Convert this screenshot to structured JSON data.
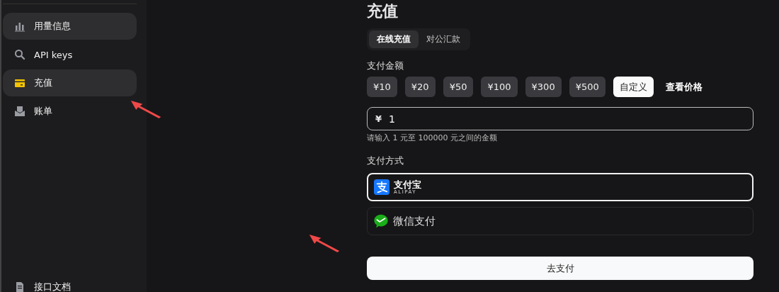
{
  "sidebar": {
    "items": [
      {
        "label": "用量信息",
        "kind": "chart",
        "selected": true
      },
      {
        "label": "API keys",
        "kind": "search",
        "selected": false
      },
      {
        "label": "充值",
        "kind": "card",
        "selected": true
      },
      {
        "label": "账单",
        "kind": "tray",
        "selected": false
      }
    ],
    "footer_item": {
      "label": "接口文档",
      "kind": "doc"
    }
  },
  "page": {
    "title": "充值",
    "tabs": [
      {
        "label": "在线充值",
        "selected": true
      },
      {
        "label": "对公汇款",
        "selected": false
      }
    ],
    "amount_label": "支付金额",
    "amounts": [
      {
        "label": "¥10",
        "kind": "chip",
        "selected": false
      },
      {
        "label": "¥20",
        "kind": "chip",
        "selected": false
      },
      {
        "label": "¥50",
        "kind": "chip",
        "selected": false
      },
      {
        "label": "¥100",
        "kind": "chip",
        "selected": false
      },
      {
        "label": "¥300",
        "kind": "chip",
        "selected": false
      },
      {
        "label": "¥500",
        "kind": "chip",
        "selected": false
      },
      {
        "label": "自定义",
        "kind": "chip",
        "selected": true
      },
      {
        "label": "查看价格",
        "kind": "link",
        "selected": false
      }
    ],
    "amount_input": {
      "prefix": "¥",
      "value": "1"
    },
    "hint": "请输入 1 元至 100000 元之间的金额",
    "method_label": "支付方式",
    "methods": [
      {
        "kind": "alipay",
        "label": "支付宝",
        "sublabel": "ALIPAY",
        "selected": true
      },
      {
        "kind": "wechat",
        "label": "微信支付",
        "selected": false
      }
    ],
    "submit": "去支付"
  },
  "annotations": [
    {
      "kind": "arrow"
    },
    {
      "kind": "arrow"
    }
  ]
}
